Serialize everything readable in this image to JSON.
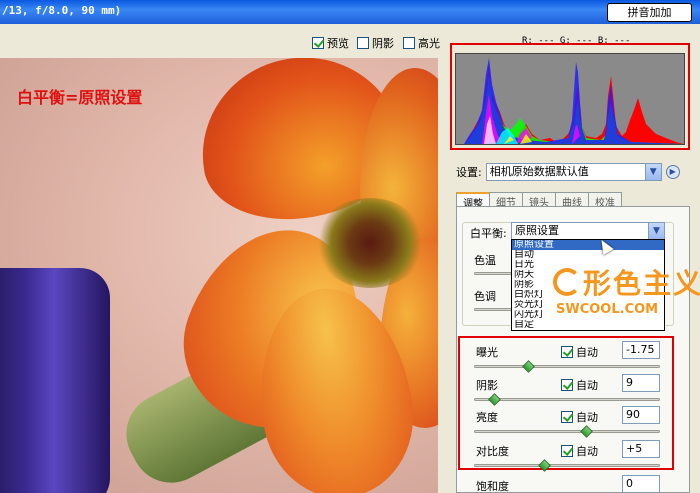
{
  "window": {
    "title": "/13, f/8.0, 90 mm)",
    "ime_button": "拼音加加"
  },
  "toolbar": {
    "preview_label": "预览",
    "preview_checked": true,
    "shadows_label": "阴影",
    "shadows_checked": false,
    "highlights_label": "高光",
    "highlights_checked": false,
    "rgb_readout": "R: --- G: --- B: ---"
  },
  "preview": {
    "annotation": "白平衡=原照设置"
  },
  "settings": {
    "label": "设置:",
    "value": "相机原始数据默认值"
  },
  "tabs": [
    {
      "label": "调整",
      "active": true
    },
    {
      "label": "细节",
      "active": false
    },
    {
      "label": "镜头",
      "active": false
    },
    {
      "label": "曲线",
      "active": false
    },
    {
      "label": "校准",
      "active": false
    }
  ],
  "white_balance": {
    "label": "白平衡:",
    "value": "原照设置",
    "temp_label": "色温",
    "tint_label": "色调",
    "options": [
      "原照设置",
      "自动",
      "日光",
      "阴天",
      "阴影",
      "白炽灯",
      "荧光灯",
      "闪光灯",
      "自定"
    ],
    "selected_index": 0
  },
  "watermark": {
    "cn": "形色主义",
    "en": "SWCOOL.COM"
  },
  "adjustments": [
    {
      "label": "曝光",
      "auto_label": "自动",
      "auto": true,
      "value": "-1.75"
    },
    {
      "label": "阴影",
      "auto_label": "自动",
      "auto": true,
      "value": "9"
    },
    {
      "label": "亮度",
      "auto_label": "自动",
      "auto": true,
      "value": "90"
    },
    {
      "label": "对比度",
      "auto_label": "自动",
      "auto": true,
      "value": "+5"
    }
  ],
  "saturation": {
    "label": "饱和度",
    "value": "0"
  },
  "colors": {
    "highlight_frame": "#e00000",
    "title_bar": "#1f5fd9",
    "selection": "#316ac5",
    "watermark": "#f5961e"
  }
}
